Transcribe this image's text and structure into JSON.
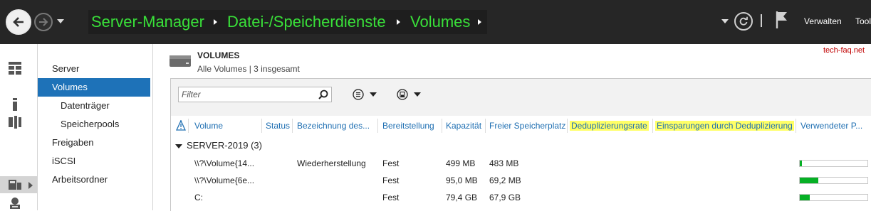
{
  "breadcrumb": [
    "Server-Manager",
    "Datei-/Speicherdienste",
    "Volumes"
  ],
  "topbar": {
    "menus": [
      "Verwalten",
      "Tool"
    ]
  },
  "nav": {
    "items": [
      {
        "label": "Server",
        "sub": false,
        "active": false
      },
      {
        "label": "Volumes",
        "sub": false,
        "active": true
      },
      {
        "label": "Datenträger",
        "sub": true,
        "active": false
      },
      {
        "label": "Speicherpools",
        "sub": true,
        "active": false
      },
      {
        "label": "Freigaben",
        "sub": false,
        "active": false
      },
      {
        "label": "iSCSI",
        "sub": false,
        "active": false
      },
      {
        "label": "Arbeitsordner",
        "sub": false,
        "active": false
      }
    ]
  },
  "main": {
    "title": "VOLUMES",
    "subtitle": "Alle Volumes | 3 insgesamt",
    "watermark": "tech-faq.net",
    "filter_placeholder": "Filter"
  },
  "table": {
    "columns": [
      "Volume",
      "Status",
      "Bezeichnung des...",
      "Bereitstellung",
      "Kapazität",
      "Freier Speicherplatz",
      "Deduplizierungsrate",
      "Einsparungen durch Deduplizierung",
      "Verwendeter P..."
    ],
    "highlighted_columns": [
      6,
      7
    ],
    "group": "SERVER-2019 (3)",
    "rows": [
      {
        "volume": "\\\\?\\Volume{14...",
        "status": "",
        "label": "Wiederherstellung",
        "provisioning": "Fest",
        "capacity": "499 MB",
        "free": "483 MB",
        "used_pct": 3
      },
      {
        "volume": "\\\\?\\Volume{6e...",
        "status": "",
        "label": "",
        "provisioning": "Fest",
        "capacity": "95,0 MB",
        "free": "69,2 MB",
        "used_pct": 27
      },
      {
        "volume": "C:",
        "status": "",
        "label": "",
        "provisioning": "Fest",
        "capacity": "79,4 GB",
        "free": "67,9 GB",
        "used_pct": 15
      }
    ]
  },
  "colors": {
    "breadcrumb": "#39e039",
    "accent": "#1e72b8",
    "header_text": "#1f6fb2",
    "highlight": "#ffff66",
    "usage_bar": "#06b025"
  }
}
